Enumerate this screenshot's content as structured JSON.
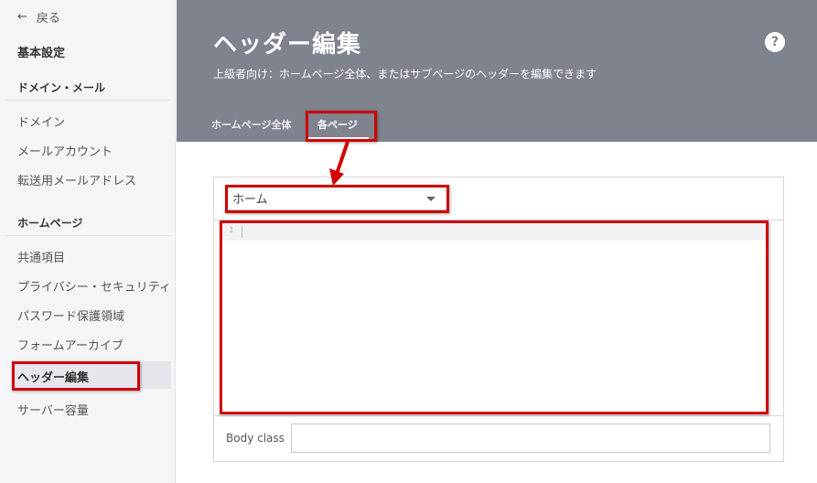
{
  "sidebar": {
    "back_icon": "left-arrow-icon",
    "back_label": "戻る",
    "section_title": "基本設定",
    "groups": [
      {
        "title": "ドメイン・メール",
        "items": [
          "ドメイン",
          "メールアカウント",
          "転送用メールアドレス"
        ]
      },
      {
        "title": "ホームページ",
        "items": [
          "共通項目",
          "プライバシー・セキュリティ",
          "パスワード保護領域",
          "フォームアーカイブ",
          "ヘッダー編集",
          "サーバー容量"
        ]
      }
    ],
    "active_item": "ヘッダー編集"
  },
  "header": {
    "title": "ヘッダー編集",
    "subtitle": "上級者向け：ホームページ全体、またはサブページのヘッダーを編集できます",
    "help_icon": "question-icon",
    "help_label": "?",
    "tabs": [
      "ホームページ全体",
      "各ページ"
    ],
    "active_tab": "各ページ"
  },
  "panel": {
    "page_select": {
      "value": "ホーム"
    },
    "editor": {
      "line_number": "1",
      "content": ""
    },
    "body_class": {
      "label": "Body class",
      "value": ""
    }
  },
  "annotation_color": "#d00000"
}
